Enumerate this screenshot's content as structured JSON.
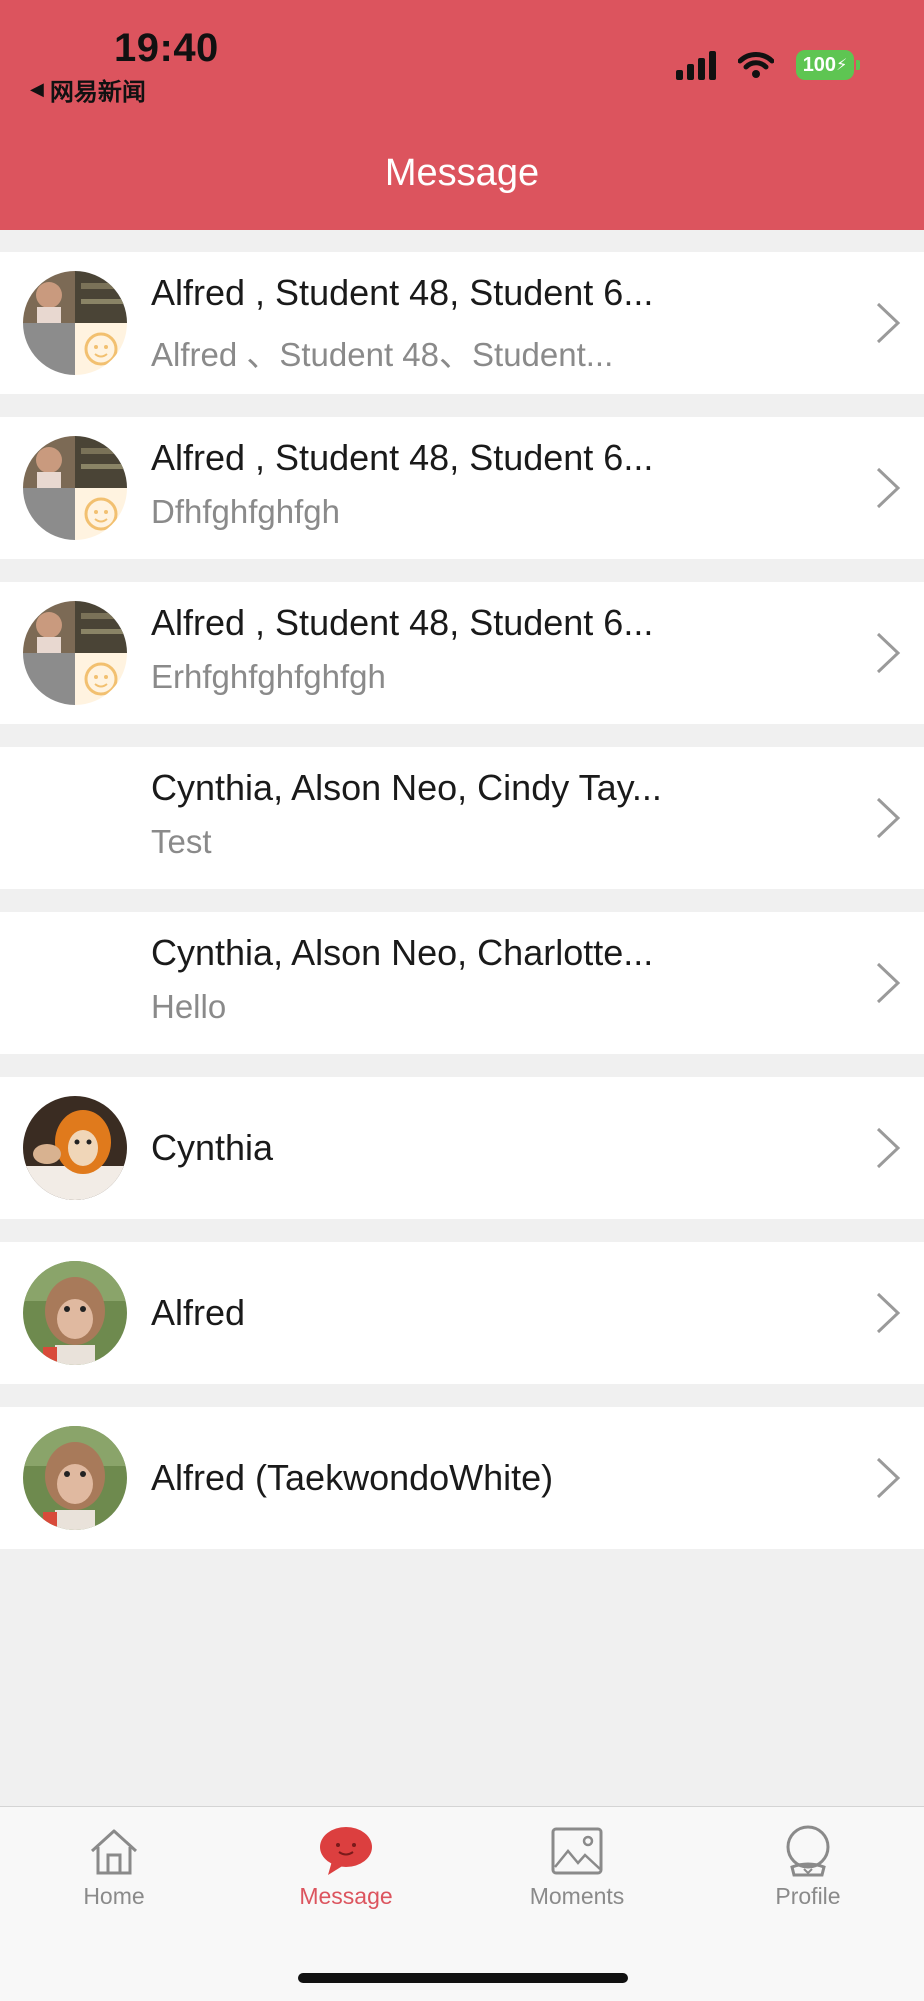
{
  "status_bar": {
    "time": "19:40",
    "back_app": "网易新闻",
    "battery": "100"
  },
  "header": {
    "title": "Message"
  },
  "conversations": [
    {
      "name": "Alfred , Student 48, Student 6...",
      "preview": "Alfred 、Student 48、Student...",
      "avatar": "group-avatar"
    },
    {
      "name": "Alfred , Student 48, Student 6...",
      "preview": "Dfhfghfghfgh",
      "avatar": "group-avatar"
    },
    {
      "name": "Alfred , Student 48, Student 6...",
      "preview": "Erhfghfghfghfgh",
      "avatar": "group-avatar"
    },
    {
      "name": "Cynthia, Alson Neo, Cindy Tay...",
      "preview": "Test",
      "avatar": "none"
    },
    {
      "name": "Cynthia, Alson Neo, Charlotte...",
      "preview": "Hello",
      "avatar": "none"
    },
    {
      "name": "Cynthia",
      "preview": "",
      "avatar": "orange-monkey-photo"
    },
    {
      "name": "Alfred",
      "preview": "",
      "avatar": "monkey-photo"
    },
    {
      "name": "Alfred  (TaekwondoWhite)",
      "preview": "",
      "avatar": "monkey-photo"
    }
  ],
  "tabs": [
    {
      "label": "Home",
      "icon": "house-icon",
      "active": false
    },
    {
      "label": "Message",
      "icon": "chat-bubble-icon",
      "active": true
    },
    {
      "label": "Moments",
      "icon": "picture-icon",
      "active": false
    },
    {
      "label": "Profile",
      "icon": "person-icon",
      "active": false
    }
  ],
  "colors": {
    "accent": "#dc545e",
    "background": "#f0f0f0",
    "battery": "#5ec552"
  }
}
